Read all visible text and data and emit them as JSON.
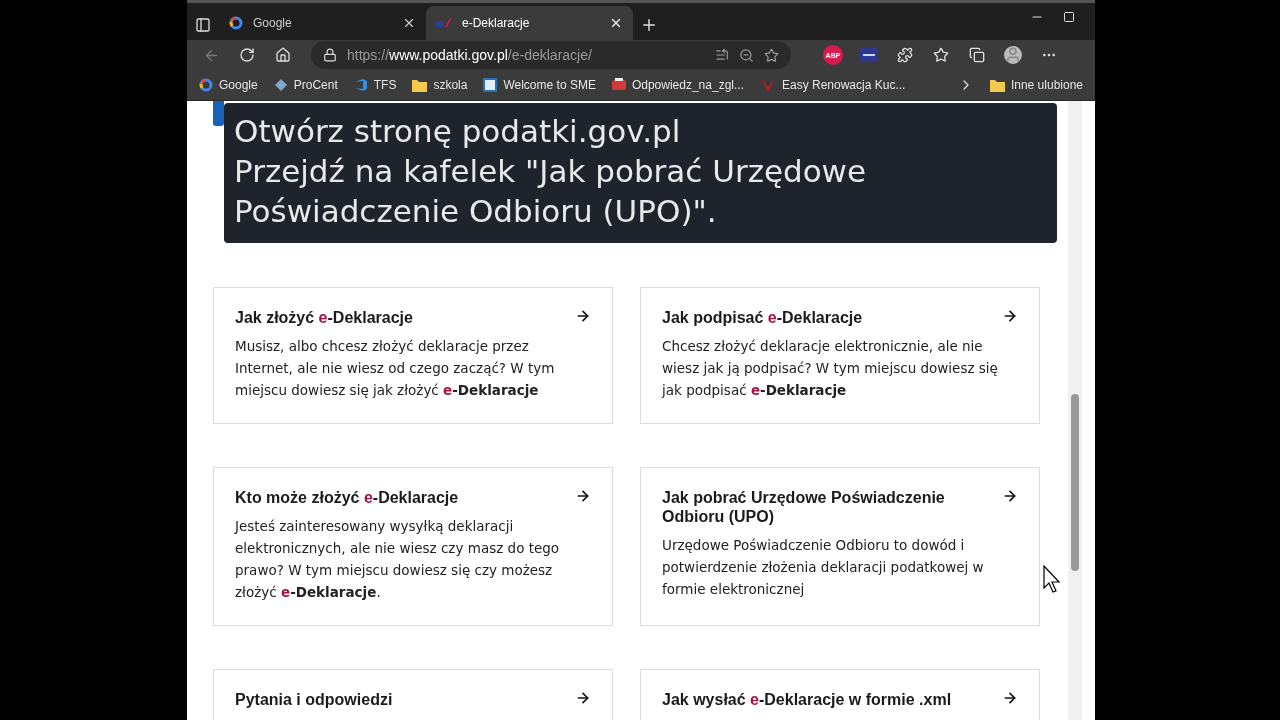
{
  "tabs": [
    {
      "title": "Google",
      "kind": "google",
      "selected": false
    },
    {
      "title": "e-Deklaracje",
      "kind": "site",
      "selected": true
    }
  ],
  "address": {
    "prefix": "https://",
    "host": "www.podatki.gov.pl",
    "path": "/e-deklaracje/"
  },
  "extensions": [
    {
      "kind": "badge",
      "label": "ABP"
    },
    {
      "kind": "card"
    }
  ],
  "bookmarks": [
    {
      "label": "Google",
      "kind": "google"
    },
    {
      "label": "ProCent",
      "kind": "diamond"
    },
    {
      "label": "TFS",
      "kind": "tfs"
    },
    {
      "label": "szkola",
      "kind": "folder"
    },
    {
      "label": "Welcome to SME",
      "kind": "app"
    },
    {
      "label": "Odpowiedz_na_zgl...",
      "kind": "pdf"
    },
    {
      "label": "Easy Renowacja Kuc...",
      "kind": "logo"
    }
  ],
  "other_bookmarks": {
    "label": "Inne ulubione"
  },
  "caption": [
    "Otwórz stronę podatki.gov.pl",
    "Przejdź na kafelek \"Jak pobrać Urzędowe",
    "Poświadczenie Odbioru (UPO)\"."
  ],
  "cards": [
    {
      "title": [
        {
          "text": "Jak złożyć "
        },
        {
          "text": "e",
          "accent": true
        },
        {
          "text": "-Deklaracje"
        }
      ],
      "description": [
        {
          "text": "Musisz, albo chcesz złożyć deklaracje przez Internet, ale nie wiesz od czego zacząć? W tym miejscu dowiesz się jak złożyć "
        },
        {
          "text": "e",
          "accent": true,
          "bold": true
        },
        {
          "text": "-Deklaracje",
          "bold": true
        }
      ]
    },
    {
      "title": [
        {
          "text": "Jak podpisać "
        },
        {
          "text": "e",
          "accent": true
        },
        {
          "text": "-Deklaracje"
        }
      ],
      "description": [
        {
          "text": "Chcesz złożyć deklaracje elektronicznie, ale nie wiesz jak ją podpisać? W tym miejscu dowiesz się jak podpisać "
        },
        {
          "text": "e",
          "accent": true,
          "bold": true
        },
        {
          "text": "-Deklaracje",
          "bold": true
        }
      ]
    },
    {
      "title": [
        {
          "text": "Kto może złożyć "
        },
        {
          "text": "e",
          "accent": true
        },
        {
          "text": "-Deklaracje"
        }
      ],
      "description": [
        {
          "text": "Jesteś zainteresowany wysyłką deklaracji elektronicznych, ale nie wiesz czy masz do tego prawo? W tym miejscu dowiesz się czy możesz złożyć "
        },
        {
          "text": "e",
          "accent": true,
          "bold": true
        },
        {
          "text": "-Deklaracje",
          "bold": true
        },
        {
          "text": "."
        }
      ]
    },
    {
      "title": [
        {
          "text": "Jak pobrać Urzędowe Poświadczenie Odbioru (UPO)"
        }
      ],
      "description": [
        {
          "text": "Urzędowe Poświadczenie Odbioru to dowód i potwierdzenie złożenia deklaracji podatkowej w formie elektronicznej"
        }
      ]
    },
    {
      "title": [
        {
          "text": "Pytania i odpowiedzi"
        }
      ]
    },
    {
      "title": [
        {
          "text": "Jak wysłać "
        },
        {
          "text": "e",
          "accent": true
        },
        {
          "text": "-Deklaracje w formie .xml"
        }
      ]
    }
  ]
}
